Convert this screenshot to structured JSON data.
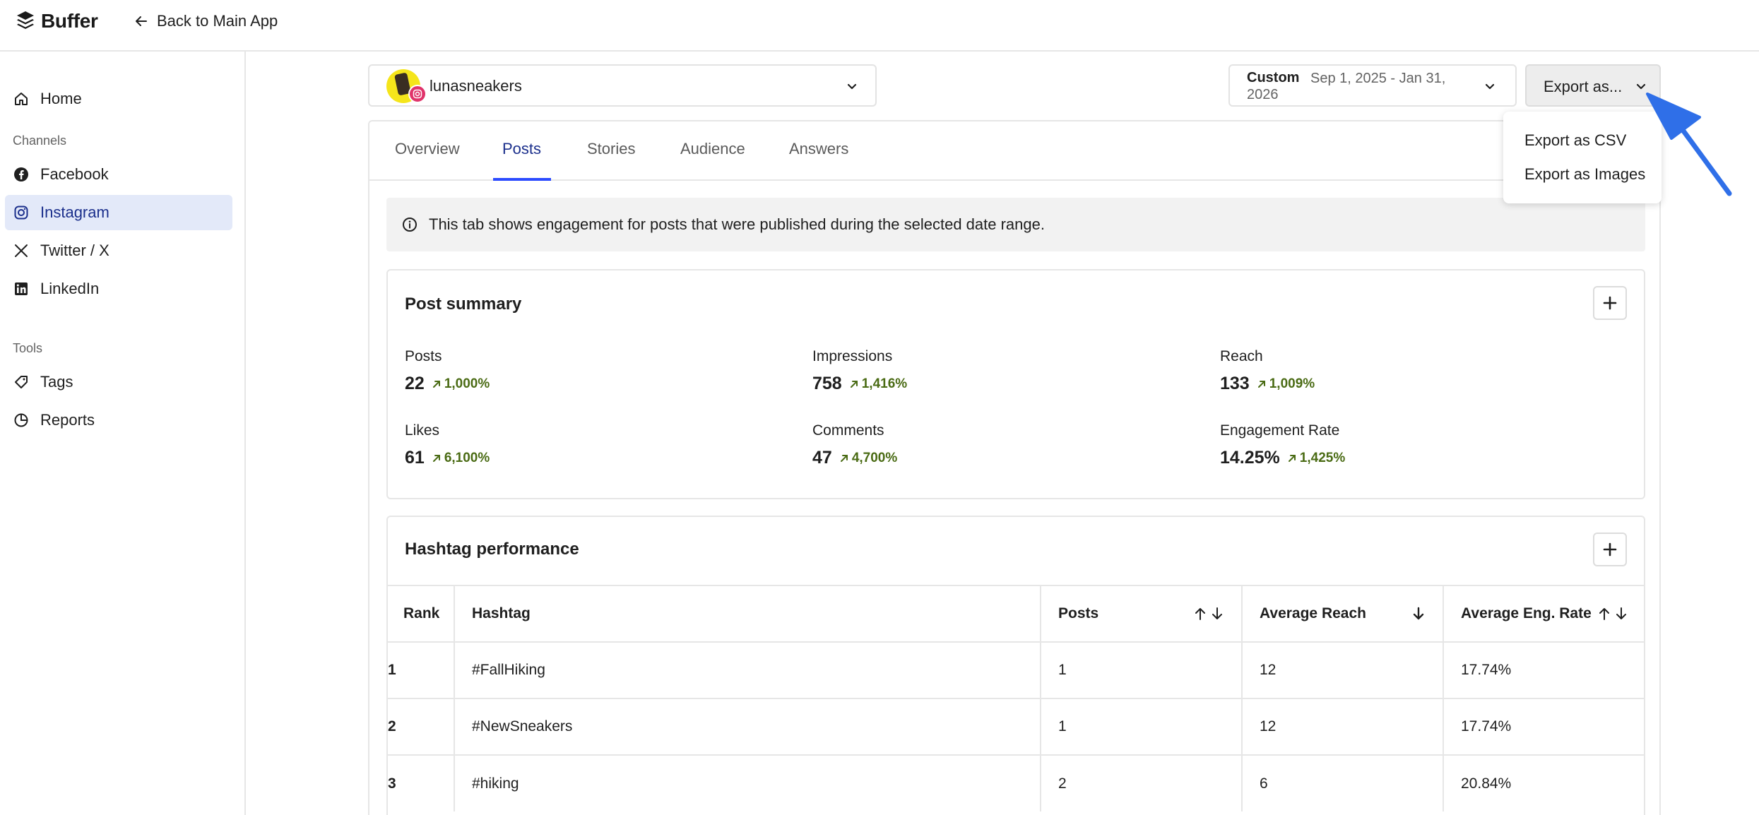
{
  "topbar": {
    "brand": "Buffer",
    "back_label": "Back to Main App"
  },
  "sidebar": {
    "home": "Home",
    "channels_heading": "Channels",
    "channels": [
      {
        "label": "Facebook",
        "icon": "facebook-icon"
      },
      {
        "label": "Instagram",
        "icon": "instagram-icon",
        "active": true
      },
      {
        "label": "Twitter / X",
        "icon": "x-icon"
      },
      {
        "label": "LinkedIn",
        "icon": "linkedin-icon"
      }
    ],
    "tools_heading": "Tools",
    "tools": [
      {
        "label": "Tags",
        "icon": "tag-icon"
      },
      {
        "label": "Reports",
        "icon": "pie-chart-icon"
      }
    ]
  },
  "account": {
    "name": "lunasneakers"
  },
  "date": {
    "preset": "Custom",
    "range_line1": "Sep 1, 2025 - Jan 31,",
    "range_line2": "2026"
  },
  "export": {
    "button_label": "Export as...",
    "options": [
      "Export as CSV",
      "Export as Images"
    ]
  },
  "tabs": [
    "Overview",
    "Posts",
    "Stories",
    "Audience",
    "Answers"
  ],
  "active_tab": "Posts",
  "notice": "This tab shows engagement for posts that were published during the selected date range.",
  "post_summary": {
    "title": "Post summary",
    "metrics": [
      {
        "label": "Posts",
        "value": "22",
        "change": "1,000%"
      },
      {
        "label": "Impressions",
        "value": "758",
        "change": "1,416%"
      },
      {
        "label": "Reach",
        "value": "133",
        "change": "1,009%"
      },
      {
        "label": "Likes",
        "value": "61",
        "change": "6,100%"
      },
      {
        "label": "Comments",
        "value": "47",
        "change": "4,700%"
      },
      {
        "label": "Engagement Rate",
        "value": "14.25%",
        "change": "1,425%"
      }
    ]
  },
  "hashtags": {
    "title": "Hashtag performance",
    "columns": [
      "Rank",
      "Hashtag",
      "Posts",
      "Average Reach",
      "Average Eng. Rate"
    ],
    "rows": [
      {
        "rank": "1",
        "hashtag": "#FallHiking",
        "posts": "1",
        "reach": "12",
        "eng": "17.74%"
      },
      {
        "rank": "2",
        "hashtag": "#NewSneakers",
        "posts": "1",
        "reach": "12",
        "eng": "17.74%"
      },
      {
        "rank": "3",
        "hashtag": "#hiking",
        "posts": "2",
        "reach": "6",
        "eng": "20.84%"
      }
    ]
  },
  "colors": {
    "active_blue": "#1b2f8c",
    "tab_underline": "#2c4bff",
    "positive_green": "#4a6b14",
    "annotation_arrow": "#2f6fe8"
  }
}
